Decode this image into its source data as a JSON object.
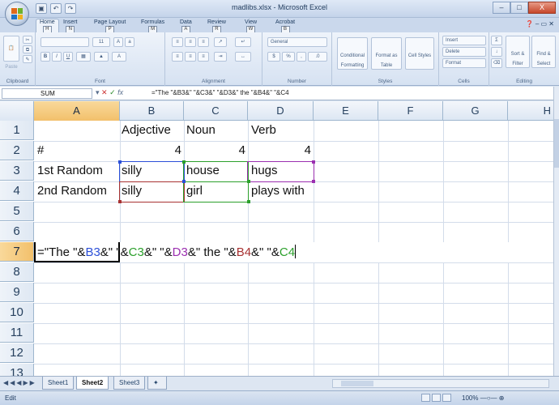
{
  "title_bar": {
    "title": "madlibs.xlsx - Microsoft Excel",
    "qat_items": [
      "save",
      "undo",
      "redo"
    ],
    "minimize": "–",
    "maximize": "□",
    "close": "X"
  },
  "tabs": [
    {
      "label": "Home",
      "key": "H"
    },
    {
      "label": "Insert",
      "key": "N"
    },
    {
      "label": "Page Layout",
      "key": "P"
    },
    {
      "label": "Formulas",
      "key": "M"
    },
    {
      "label": "Data",
      "key": "A"
    },
    {
      "label": "Review",
      "key": "R"
    },
    {
      "label": "View",
      "key": "W"
    },
    {
      "label": "Acrobat",
      "key": "B"
    }
  ],
  "ribbon": {
    "groups": {
      "clipboard": "Clipboard",
      "font": "Font",
      "alignment": "Alignment",
      "number": "Number",
      "styles": "Styles",
      "cells": "Cells",
      "editing": "Editing"
    },
    "paste": "Paste",
    "font_size": "11",
    "number_format": "General",
    "cond_format": "Conditional Formatting",
    "format_table": "Format as Table",
    "cell_styles": "Cell Styles",
    "insert": "Insert",
    "delete": "Delete",
    "format": "Format",
    "sort_filter": "Sort & Filter",
    "find_select": "Find & Select"
  },
  "formula_bar": {
    "name_box": "SUM",
    "formula": "=\"The \"&B3&\" \"&C3&\" \"&D3&\" the \"&B4&\" \"&C4"
  },
  "columns": [
    "A",
    "B",
    "C",
    "D",
    "E",
    "F",
    "G",
    "H"
  ],
  "rows": [
    "1",
    "2",
    "3",
    "4",
    "5",
    "6",
    "7",
    "8",
    "9",
    "10",
    "11",
    "12",
    "13"
  ],
  "cells": {
    "B1": "Adjective",
    "C1": "Noun",
    "D1": "Verb",
    "A2": "#",
    "B2": "4",
    "C2": "4",
    "D2": "4",
    "A3": "1st Random",
    "B3": "silly",
    "C3": "house",
    "D3": "hugs",
    "A4": "2nd Random",
    "B4": "silly",
    "C4": "girl",
    "D4": "plays with"
  },
  "edit": {
    "t1": "=\"The \"&",
    "r1": "B3",
    "t2": "&\" \"&",
    "r2": "C3",
    "t3": "&\" \"&",
    "r3": "D3",
    "t4": "&\" the \"&",
    "r4": "B4",
    "t5": "&\" \"&",
    "r5": "C4"
  },
  "ref_colors": {
    "B3": "#2b4fd8",
    "C3": "#2ca02c",
    "D3": "#9b2fb0",
    "B4": "#a83232",
    "C4": "#2ca02c"
  },
  "sheet_tabs": [
    "Sheet1",
    "Sheet2",
    "Sheet3"
  ],
  "active_sheet": "Sheet2",
  "status": {
    "mode": "Edit",
    "zoom": "100%"
  }
}
